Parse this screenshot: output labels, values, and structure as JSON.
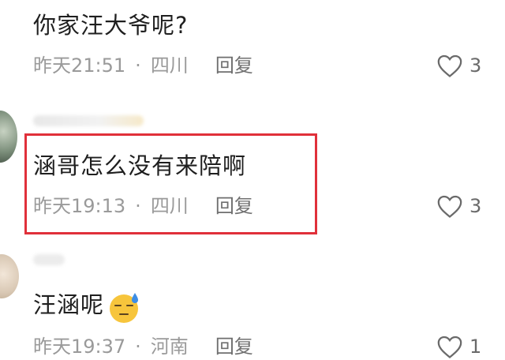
{
  "comments": [
    {
      "text": "你家汪大爷呢?",
      "time": "昨天21:51",
      "separator": "·",
      "location": "四川",
      "reply": "回复",
      "likes": "3",
      "icon": "heart-outline-icon"
    },
    {
      "text": "涵哥怎么没有来陪啊",
      "time": "昨天19:13",
      "separator": "·",
      "location": "四川",
      "reply": "回复",
      "likes": "3",
      "icon": "heart-outline-icon",
      "highlighted": true,
      "highlight_color": "#e0303a"
    },
    {
      "text": "汪涵呢",
      "emoji": "sweat-smile-emoji",
      "time": "昨天19:37",
      "separator": "·",
      "location": "河南",
      "reply": "回复",
      "likes": "1",
      "icon": "heart-outline-icon"
    }
  ],
  "colors": {
    "text": "#1f1f1f",
    "meta": "#9a9a9a",
    "highlight": "#e0303a",
    "background": "#ffffff"
  }
}
